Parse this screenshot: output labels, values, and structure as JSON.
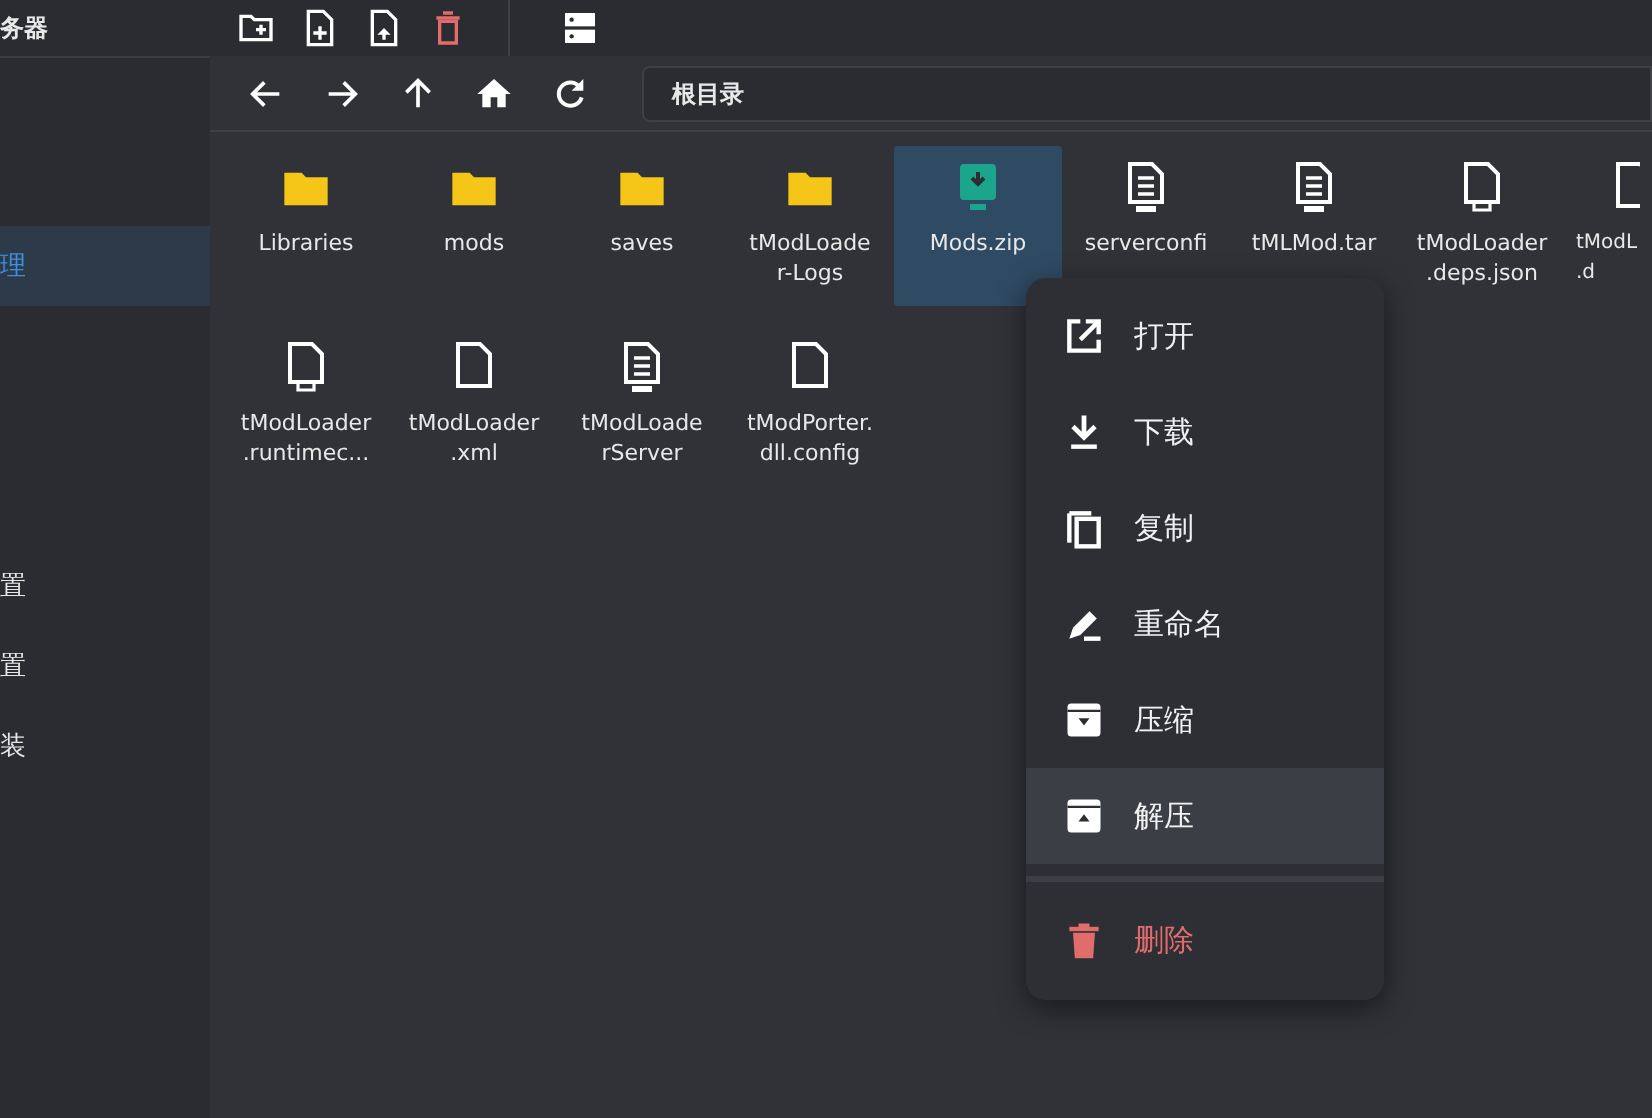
{
  "sidebar": {
    "title": "务器",
    "items": [
      {
        "label": "理",
        "selected": true
      },
      {
        "label": "置",
        "selected": false
      },
      {
        "label": "置",
        "selected": false
      },
      {
        "label": "装",
        "selected": false
      }
    ]
  },
  "breadcrumb": "根目录",
  "files": [
    {
      "kind": "folder",
      "lines": [
        "Libraries"
      ],
      "selected": false
    },
    {
      "kind": "folder",
      "lines": [
        "mods"
      ],
      "selected": false
    },
    {
      "kind": "folder",
      "lines": [
        "saves"
      ],
      "selected": false
    },
    {
      "kind": "folder",
      "lines": [
        "tModLoade",
        "r-Logs"
      ],
      "selected": false
    },
    {
      "kind": "zip",
      "lines": [
        "Mods.zip"
      ],
      "selected": true
    },
    {
      "kind": "txt",
      "lines": [
        "serverconfi"
      ],
      "selected": false
    },
    {
      "kind": "txt",
      "lines": [
        "tMLMod.tar"
      ],
      "selected": false
    },
    {
      "kind": "json",
      "lines": [
        "tModLoader",
        ".deps.json"
      ],
      "selected": false
    },
    {
      "kind": "file",
      "lines": [
        "tModL",
        ".d"
      ],
      "selected": false
    },
    {
      "kind": "json",
      "lines": [
        "tModLoader",
        ".runtimec..."
      ],
      "selected": false
    },
    {
      "kind": "file",
      "lines": [
        "tModLoader",
        ".xml"
      ],
      "selected": false
    },
    {
      "kind": "txt",
      "lines": [
        "tModLoade",
        "rServer"
      ],
      "selected": false
    },
    {
      "kind": "file",
      "lines": [
        "tModPorter.",
        "dll.config"
      ],
      "selected": false
    }
  ],
  "context_menu": [
    {
      "kind": "open",
      "label": "打开",
      "selected": false
    },
    {
      "kind": "download",
      "label": "下载",
      "selected": false
    },
    {
      "kind": "copy",
      "label": "复制",
      "selected": false
    },
    {
      "kind": "rename",
      "label": "重命名",
      "selected": false
    },
    {
      "kind": "compress",
      "label": "压缩",
      "selected": false
    },
    {
      "kind": "extract",
      "label": "解压",
      "selected": true
    },
    {
      "kind": "delete",
      "label": "删除",
      "selected": false
    }
  ]
}
